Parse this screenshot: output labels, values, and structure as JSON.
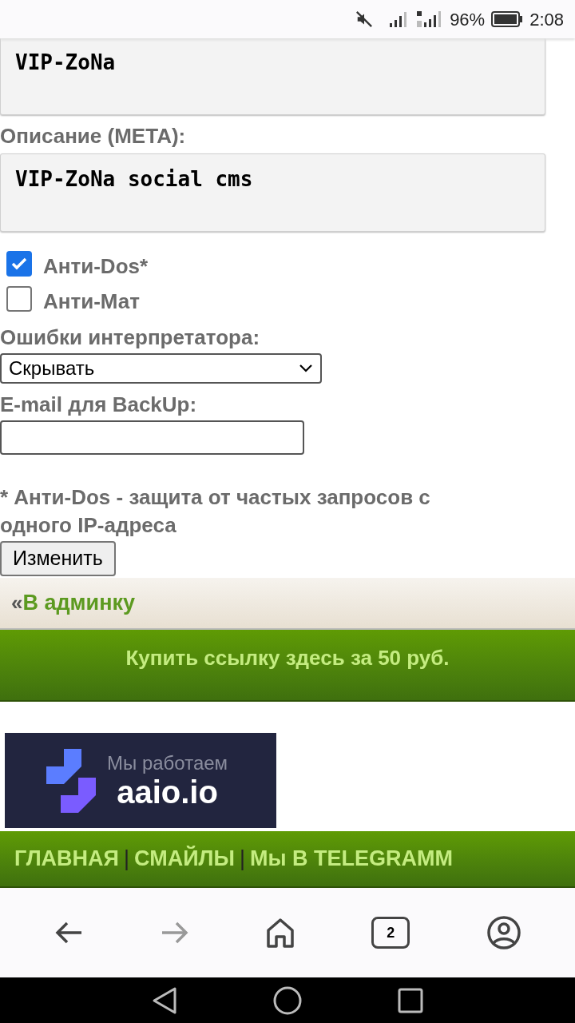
{
  "status_bar": {
    "battery": "96%",
    "time": "2:08"
  },
  "form": {
    "fields": [
      {
        "kind": "textarea",
        "value": "VIP-ZoNa"
      },
      {
        "kind": "label",
        "text": "Описание (META):"
      },
      {
        "kind": "textarea",
        "value": "VIP-ZoNa social cms"
      },
      {
        "kind": "checkbox",
        "label": "Анти-Dos*",
        "checked": true
      },
      {
        "kind": "checkbox",
        "label": "Анти-Мат",
        "checked": false
      },
      {
        "kind": "label",
        "text": "Ошибки интерпретатора:"
      },
      {
        "kind": "select",
        "value": "Скрывать"
      },
      {
        "kind": "label",
        "text": "E-mail для BackUp:"
      },
      {
        "kind": "input"
      }
    ],
    "note": "* Анти-Dos - защита от частых запросов с одного IP-адреса",
    "submit": "Изменить"
  },
  "admin_link": {
    "prefix": "«",
    "label": "В админку"
  },
  "buy_link": "Купить ссылку здесь за 50 руб.",
  "banner": {
    "line1": "Мы работаем",
    "line2": "aaio.io"
  },
  "footer": {
    "separator": "|",
    "links": [
      "ГЛАВНАЯ",
      "СМАЙЛЫ",
      "Мы В TELEGRAMM"
    ]
  },
  "browser": {
    "tabs_count": "2"
  }
}
